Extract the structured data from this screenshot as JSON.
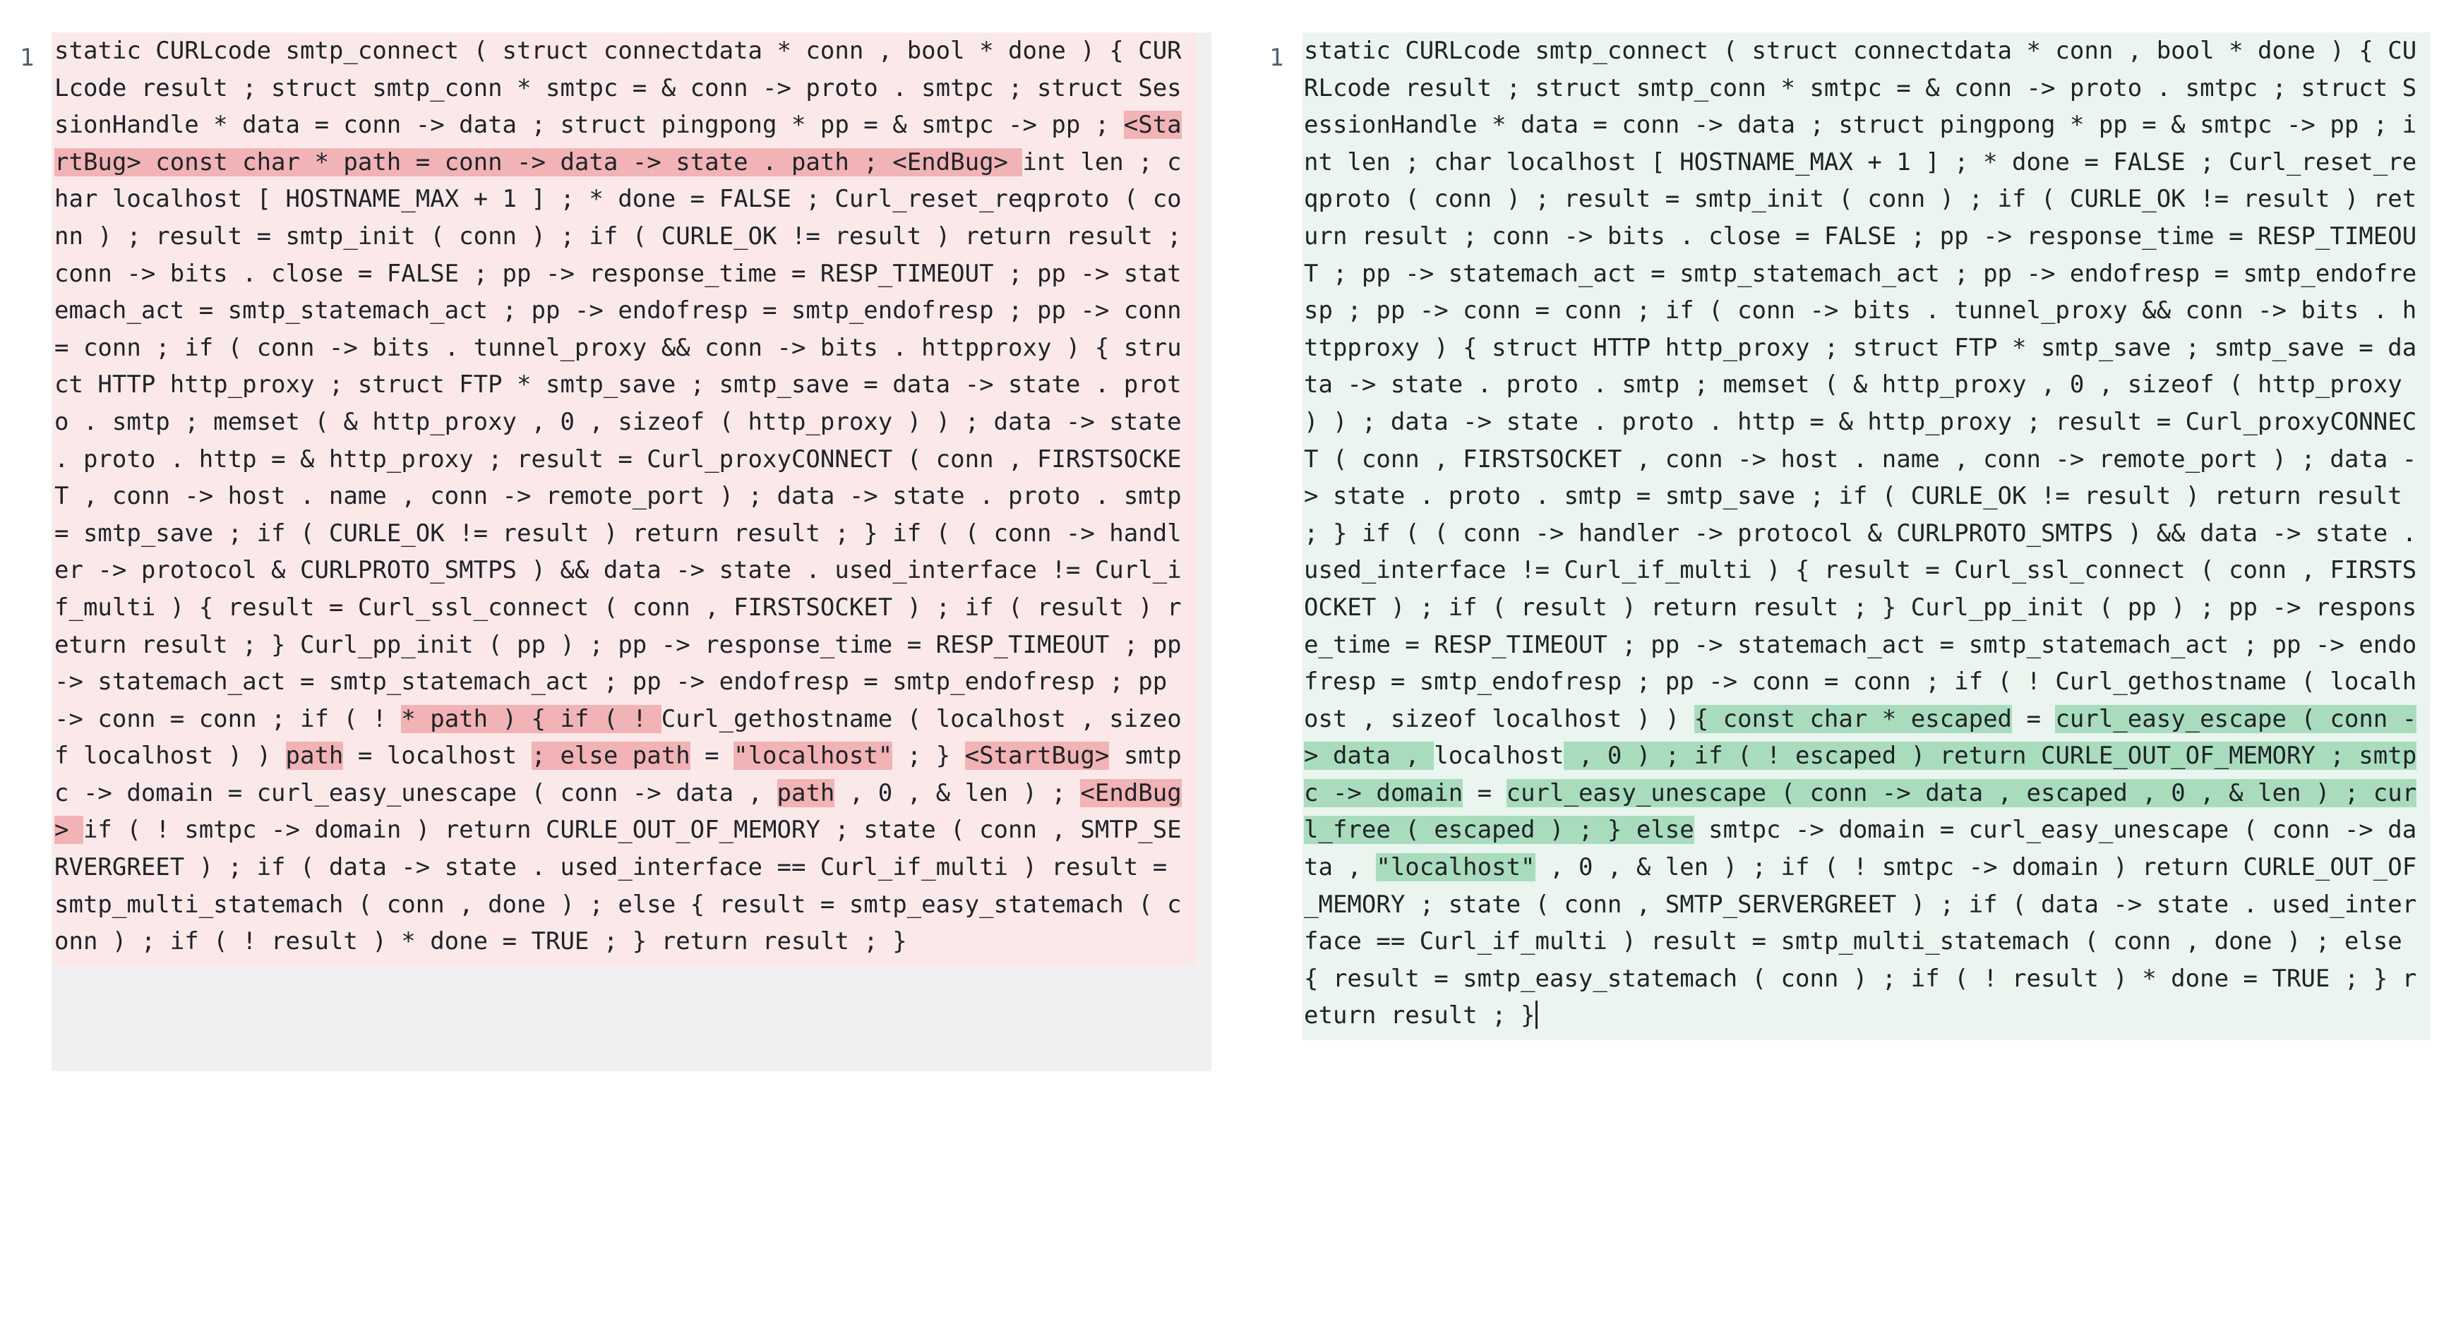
{
  "left": {
    "line_number": "1",
    "segments": [
      {
        "t": "static CURLcode smtp_connect ( struct connectdata * conn , bool * done ) { CURLcode result ; struct smtp_conn * smtpc = & conn -> proto . smtpc ; struct SessionHandle * data = conn -> data ; struct pingpong * pp = & smtpc -> pp ; ",
        "h": ""
      },
      {
        "t": "<StartBug> const char * path = conn -> data -> state . path ; <EndBug> ",
        "h": "del"
      },
      {
        "t": "int len ; char localhost [ HOSTNAME_MAX + 1 ] ; * done = FALSE ; Curl_reset_reqproto ( conn ) ; result = smtp_init ( conn ) ; if ( CURLE_OK != result ) return result ; conn -> bits . close = FALSE ; pp -> response_time = RESP_TIMEOUT ; pp -> statemach_act = smtp_statemach_act ; pp -> endofresp = smtp_endofresp ; pp -> conn = conn ; if ( conn -> bits . tunnel_proxy && conn -> bits . httpproxy ) { struct HTTP http_proxy ; struct FTP * smtp_save ; smtp_save = data -> state . proto . smtp ; memset ( & http_proxy , 0 , sizeof ( http_proxy ) ) ; data -> state . proto . http = & http_proxy ; result = Curl_proxyCONNECT ( conn , FIRSTSOCKET , conn -> host . name , conn -> remote_port ) ; data -> state . proto . smtp = smtp_save ; if ( CURLE_OK != result ) return result ; } if ( ( conn -> handler -> protocol & CURLPROTO_SMTPS ) && data -> state . used_interface != Curl_if_multi ) { result = Curl_ssl_connect ( conn , FIRSTSOCKET ) ; if ( result ) return result ; } Curl_pp_init ( pp ) ; pp -> response_time = RESP_TIMEOUT ; pp -> statemach_act = smtp_statemach_act ; pp -> endofresp = smtp_endofresp ; pp -> conn = conn ; if ( ! ",
        "h": ""
      },
      {
        "t": "* path ) { if ( ! ",
        "h": "del"
      },
      {
        "t": "Curl_gethostname ( localhost , sizeof localhost ) ) ",
        "h": ""
      },
      {
        "t": "path",
        "h": "del"
      },
      {
        "t": " = localhost ",
        "h": ""
      },
      {
        "t": "; else path",
        "h": "del"
      },
      {
        "t": " = ",
        "h": ""
      },
      {
        "t": "\"localhost\"",
        "h": "del"
      },
      {
        "t": " ; } ",
        "h": ""
      },
      {
        "t": "<StartBug>",
        "h": "del"
      },
      {
        "t": " smtpc -> domain = curl_easy_unescape ( conn -> data , ",
        "h": ""
      },
      {
        "t": "path",
        "h": "del"
      },
      {
        "t": " , 0 , & len ) ; ",
        "h": ""
      },
      {
        "t": "<EndBug> ",
        "h": "del"
      },
      {
        "t": "if ( ! smtpc -> domain ) return CURLE_OUT_OF_MEMORY ; state ( conn , SMTP_SERVERGREET ) ; if ( data -> state . used_interface == Curl_if_multi ) result = smtp_multi_statemach ( conn , done ) ; else { result = smtp_easy_statemach ( conn ) ; if ( ! result ) * done = TRUE ; } return result ; }",
        "h": ""
      }
    ]
  },
  "right": {
    "line_number": "1",
    "segments": [
      {
        "t": "static CURLcode smtp_connect ( struct connectdata * conn , bool * done ) { CURLcode result ; struct smtp_conn * smtpc = & conn -> proto . smtpc ; struct SessionHandle * data = conn -> data ; struct pingpong * pp = & smtpc -> pp ; int len ; char localhost [ HOSTNAME_MAX + 1 ] ; * done = FALSE ; Curl_reset_reqproto ( conn ) ; result = smtp_init ( conn ) ; if ( CURLE_OK != result ) return result ; conn -> bits . close = FALSE ; pp -> response_time = RESP_TIMEOUT ; pp -> statemach_act = smtp_statemach_act ; pp -> endofresp = smtp_endofresp ; pp -> conn = conn ; if ( conn -> bits . tunnel_proxy && conn -> bits . httpproxy ) { struct HTTP http_proxy ; struct FTP * smtp_save ; smtp_save = data -> state . proto . smtp ; memset ( & http_proxy , 0 , sizeof ( http_proxy ) ) ; data -> state . proto . http = & http_proxy ; result = Curl_proxyCONNECT ( conn , FIRSTSOCKET , conn -> host . name , conn -> remote_port ) ; data -> state . proto . smtp = smtp_save ; if ( CURLE_OK != result ) return result ; } if ( ( conn -> handler -> protocol & CURLPROTO_SMTPS ) && data -> state . used_interface != Curl_if_multi ) { result = Curl_ssl_connect ( conn , FIRSTSOCKET ) ; if ( result ) return result ; } Curl_pp_init ( pp ) ; pp -> response_time = RESP_TIMEOUT ; pp -> statemach_act = smtp_statemach_act ; pp -> endofresp = smtp_endofresp ; pp -> conn = conn ; if ( ! Curl_gethostname ( localhost , sizeof localhost ) ) ",
        "h": ""
      },
      {
        "t": "{ const char * escaped",
        "h": "ins"
      },
      {
        "t": " = ",
        "h": ""
      },
      {
        "t": "curl_easy_escape ( conn -> data , ",
        "h": "ins"
      },
      {
        "t": "localhost",
        "h": ""
      },
      {
        "t": " , 0 ) ; if ( ! escaped ) return CURLE_OUT_OF_MEMORY ; smtpc -> domain",
        "h": "ins"
      },
      {
        "t": " = ",
        "h": ""
      },
      {
        "t": "curl_easy_unescape ( conn -> data , escaped , 0 , & len ) ; curl_free ( escaped ) ; } ",
        "h": "ins"
      },
      {
        "t": "else",
        "h": "ins"
      },
      {
        "t": " smtpc -> domain = curl_easy_unescape ( conn -> data , ",
        "h": ""
      },
      {
        "t": "\"localhost\"",
        "h": "ins"
      },
      {
        "t": " , 0 , & len ) ; if ( ! smtpc -> domain ) return CURLE_OUT_OF_MEMORY ; state ( conn , SMTP_SERVERGREET ) ; if ( data -> state . used_interface == Curl_if_multi ) result = smtp_multi_statemach ( conn , done ) ; else { result = smtp_easy_statemach ( conn ) ; if ( ! result ) * done = TRUE ; } return result ; }",
        "h": ""
      }
    ]
  },
  "colors": {
    "removed_bg": "#fbe9ea",
    "removed_highlight": "#f1b3b5",
    "added_bg": "#e9f5ee",
    "added_highlight": "#a9dcbd",
    "empty_area": "#f0f0f2"
  }
}
